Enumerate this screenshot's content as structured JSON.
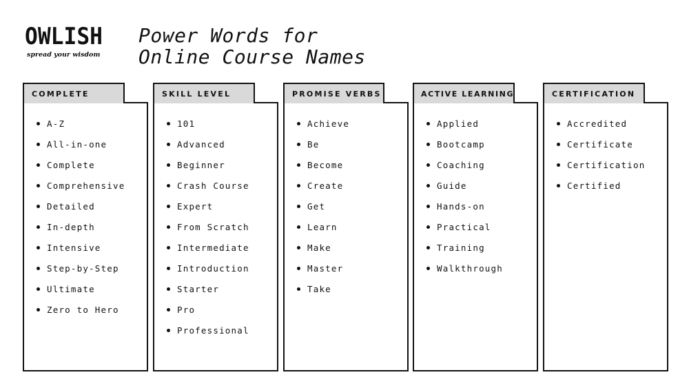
{
  "brand": {
    "name": "OWLISH",
    "tagline": "spread your wisdom"
  },
  "title": {
    "line1": "Power Words for",
    "line2": "Online Course Names"
  },
  "categories": [
    {
      "label": "COMPLETE",
      "items": [
        "A-Z",
        "All-in-one",
        "Complete",
        "Comprehensive",
        "Detailed",
        "In-depth",
        "Intensive",
        "Step-by-Step",
        "Ultimate",
        "Zero to Hero"
      ]
    },
    {
      "label": "SKILL LEVEL",
      "items": [
        "101",
        "Advanced",
        "Beginner",
        "Crash Course",
        "Expert",
        "From Scratch",
        "Intermediate",
        "Introduction",
        "Starter",
        "Pro",
        "Professional"
      ]
    },
    {
      "label": "PROMISE VERBS",
      "items": [
        "Achieve",
        "Be",
        "Become",
        "Create",
        "Get",
        "Learn",
        "Make",
        "Master",
        "Take"
      ]
    },
    {
      "label": "ACTIVE LEARNING",
      "items": [
        "Applied",
        "Bootcamp",
        "Coaching",
        "Guide",
        "Hands-on",
        "Practical",
        "Training",
        "Walkthrough"
      ]
    },
    {
      "label": "CERTIFICATION",
      "items": [
        "Accredited",
        "Certificate",
        "Certification",
        "Certified"
      ]
    }
  ],
  "colors": {
    "tab_bg": "#d9d9d9",
    "border": "#111111",
    "background": "#ffffff"
  }
}
